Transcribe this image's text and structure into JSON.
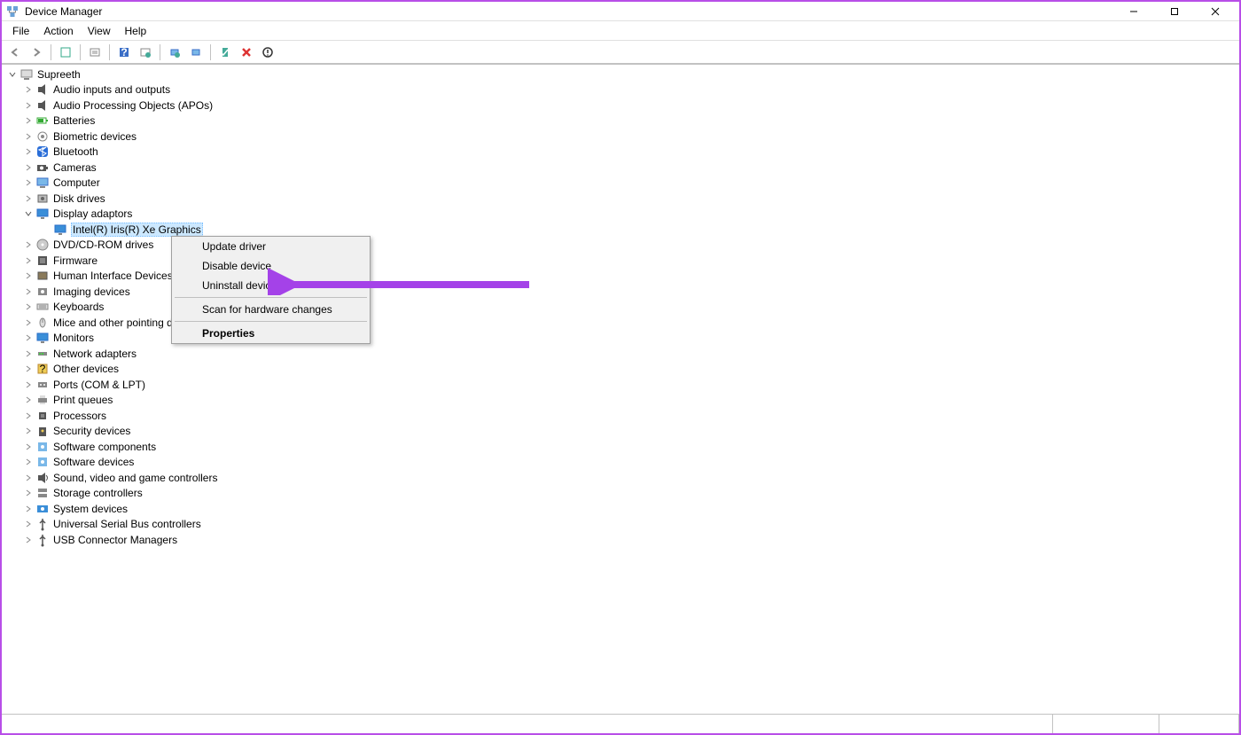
{
  "window": {
    "title": "Device Manager"
  },
  "menus": [
    "File",
    "Action",
    "View",
    "Help"
  ],
  "root": {
    "label": "Supreeth"
  },
  "categories": [
    {
      "label": "Audio inputs and outputs",
      "icon": "speaker"
    },
    {
      "label": "Audio Processing Objects (APOs)",
      "icon": "speaker"
    },
    {
      "label": "Batteries",
      "icon": "battery"
    },
    {
      "label": "Biometric devices",
      "icon": "biometric"
    },
    {
      "label": "Bluetooth",
      "icon": "bluetooth"
    },
    {
      "label": "Cameras",
      "icon": "camera"
    },
    {
      "label": "Computer",
      "icon": "computer"
    },
    {
      "label": "Disk drives",
      "icon": "disk"
    },
    {
      "label": "Display adaptors",
      "icon": "display",
      "expanded": true,
      "children": [
        {
          "label": "Intel(R) Iris(R) Xe Graphics",
          "icon": "display",
          "selected": true
        }
      ]
    },
    {
      "label": "DVD/CD-ROM drives",
      "icon": "dvd"
    },
    {
      "label": "Firmware",
      "icon": "firmware"
    },
    {
      "label": "Human Interface Devices",
      "icon": "hid"
    },
    {
      "label": "Imaging devices",
      "icon": "imaging"
    },
    {
      "label": "Keyboards",
      "icon": "keyboard"
    },
    {
      "label": "Mice and other pointing devices",
      "icon": "mouse",
      "truncated": "Mice and other pointing d"
    },
    {
      "label": "Monitors",
      "icon": "monitor"
    },
    {
      "label": "Network adapters",
      "icon": "network"
    },
    {
      "label": "Other devices",
      "icon": "other"
    },
    {
      "label": "Ports (COM & LPT)",
      "icon": "port"
    },
    {
      "label": "Print queues",
      "icon": "printer"
    },
    {
      "label": "Processors",
      "icon": "cpu"
    },
    {
      "label": "Security devices",
      "icon": "security"
    },
    {
      "label": "Software components",
      "icon": "software"
    },
    {
      "label": "Software devices",
      "icon": "software"
    },
    {
      "label": "Sound, video and game controllers",
      "icon": "sound"
    },
    {
      "label": "Storage controllers",
      "icon": "storage"
    },
    {
      "label": "System devices",
      "icon": "system"
    },
    {
      "label": "Universal Serial Bus controllers",
      "icon": "usb"
    },
    {
      "label": "USB Connector Managers",
      "icon": "usb"
    }
  ],
  "context_menu": {
    "items": [
      {
        "label": "Update driver"
      },
      {
        "label": "Disable device"
      },
      {
        "label": "Uninstall device"
      },
      {
        "sep": true
      },
      {
        "label": "Scan for hardware changes"
      },
      {
        "sep": true
      },
      {
        "label": "Properties",
        "bold": true
      }
    ]
  },
  "annotation": {
    "color": "#a442e8"
  }
}
